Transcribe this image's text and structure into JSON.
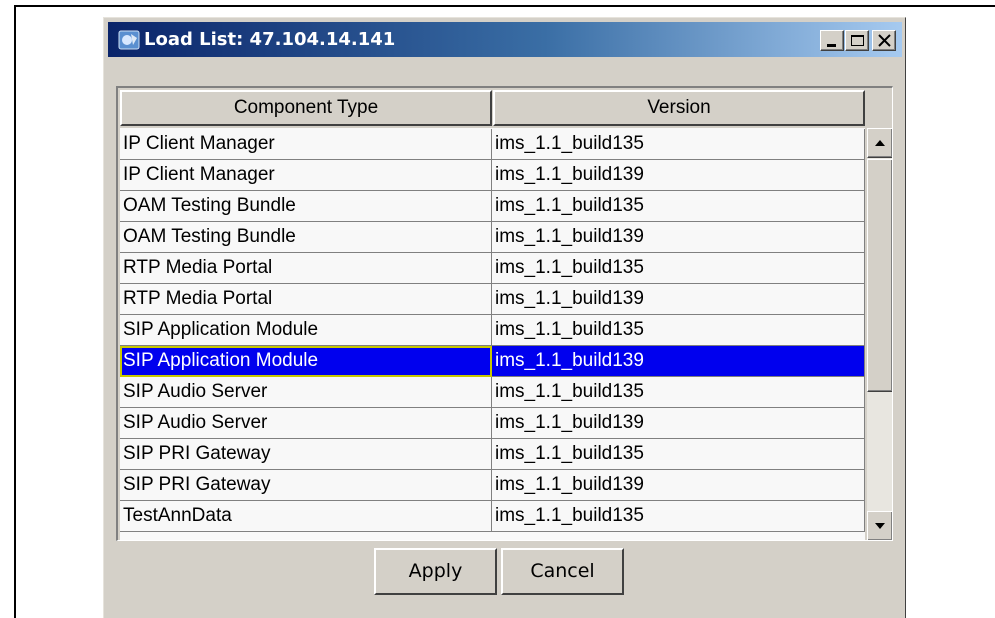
{
  "window": {
    "title": "Load List: 47.104.14.141",
    "controls": [
      "minimize-icon",
      "maximize-icon",
      "close-icon"
    ]
  },
  "table": {
    "headers": {
      "type": "Component Type",
      "version": "Version"
    },
    "rows": [
      {
        "type": "IP Client Manager",
        "version": "ims_1.1_build135"
      },
      {
        "type": "IP Client Manager",
        "version": "ims_1.1_build139"
      },
      {
        "type": "OAM Testing Bundle",
        "version": "ims_1.1_build135"
      },
      {
        "type": "OAM Testing Bundle",
        "version": "ims_1.1_build139"
      },
      {
        "type": "RTP Media Portal",
        "version": "ims_1.1_build135"
      },
      {
        "type": "RTP Media Portal",
        "version": "ims_1.1_build139"
      },
      {
        "type": "SIP Application Module",
        "version": "ims_1.1_build135"
      },
      {
        "type": "SIP Application Module",
        "version": "ims_1.1_build139",
        "selected": true
      },
      {
        "type": "SIP Audio Server",
        "version": "ims_1.1_build135"
      },
      {
        "type": "SIP Audio Server",
        "version": "ims_1.1_build139"
      },
      {
        "type": "SIP PRI Gateway",
        "version": "ims_1.1_build135"
      },
      {
        "type": "SIP PRI Gateway",
        "version": "ims_1.1_build139"
      },
      {
        "type": "TestAnnData",
        "version": "ims_1.1_build135"
      }
    ]
  },
  "buttons": {
    "apply": "Apply",
    "cancel": "Cancel"
  },
  "colors": {
    "selection": "#0000ee",
    "titlebar": "#0a246a"
  }
}
